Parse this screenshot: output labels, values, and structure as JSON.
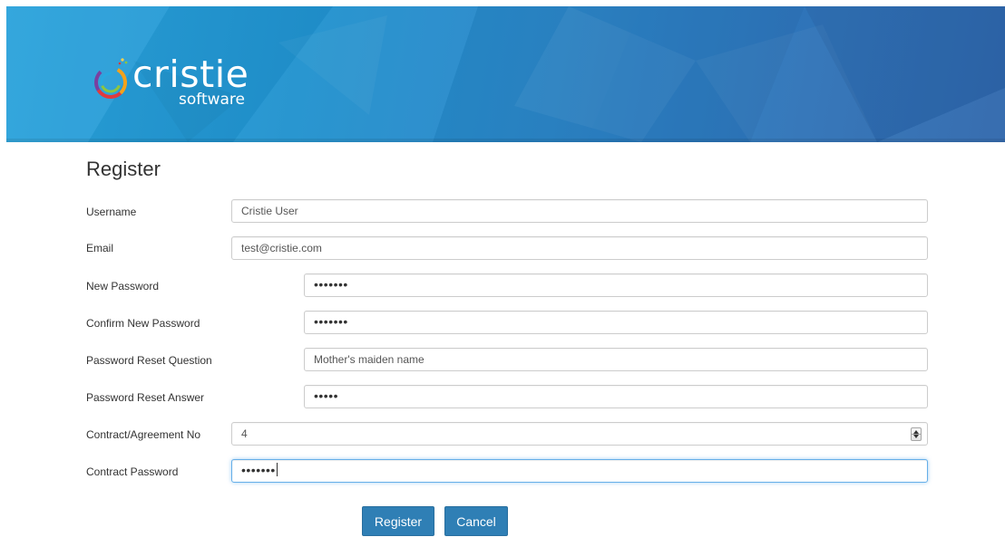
{
  "brand": {
    "name": "cristie",
    "tagline": "software",
    "banner_color_start": "#2aa3dc",
    "banner_color_end": "#2e66ab"
  },
  "page": {
    "title": "Register"
  },
  "form": {
    "username": {
      "label": "Username",
      "value": "Cristie User"
    },
    "email": {
      "label": "Email",
      "value": "test@cristie.com"
    },
    "new_password": {
      "label": "New Password",
      "value": "•••••••"
    },
    "confirm_password": {
      "label": "Confirm New Password",
      "value": "•••••••"
    },
    "reset_question": {
      "label": "Password Reset Question",
      "value": "Mother's maiden name"
    },
    "reset_answer": {
      "label": "Password Reset Answer",
      "value": "•••••"
    },
    "contract_no": {
      "label": "Contract/Agreement No",
      "value": "4"
    },
    "contract_password": {
      "label": "Contract Password",
      "value": "•••••••"
    }
  },
  "actions": {
    "register": "Register",
    "cancel": "Cancel"
  },
  "colors": {
    "button": "#2f7fb5",
    "focus_border": "#66afe9"
  }
}
